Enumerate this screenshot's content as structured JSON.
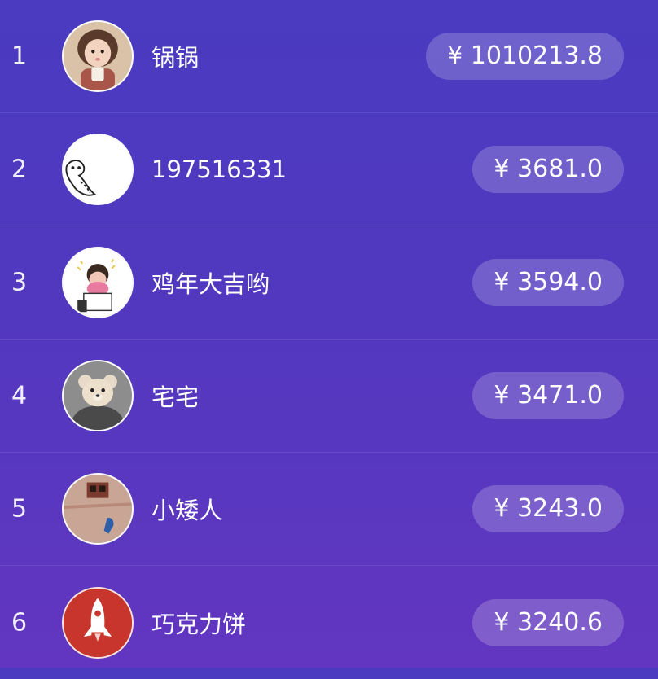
{
  "leaderboard": {
    "rows": [
      {
        "rank": "1",
        "name": "锅锅",
        "amount": "¥ 1010213.8",
        "avatar_icon": "girl-photo-avatar-icon"
      },
      {
        "rank": "2",
        "name": "197516331",
        "amount": "¥ 3681.0",
        "avatar_icon": "cartoon-character-avatar-icon"
      },
      {
        "rank": "3",
        "name": "鸡年大吉哟",
        "amount": "¥ 3594.0",
        "avatar_icon": "cartoon-boy-avatar-icon"
      },
      {
        "rank": "4",
        "name": "宅宅",
        "amount": "¥ 3471.0",
        "avatar_icon": "teddy-bear-avatar-icon"
      },
      {
        "rank": "5",
        "name": "小矮人",
        "amount": "¥ 3243.0",
        "avatar_icon": "wall-photo-avatar-icon"
      },
      {
        "rank": "6",
        "name": "巧克力饼",
        "amount": "¥ 3240.6",
        "avatar_icon": "rocket-avatar-icon"
      }
    ]
  },
  "colors": {
    "background_top": "#4a3bc0",
    "background_bottom": "#6236c0",
    "pill_fill": "rgba(255,255,255,0.20)",
    "rocket_red": "#c8352c"
  }
}
